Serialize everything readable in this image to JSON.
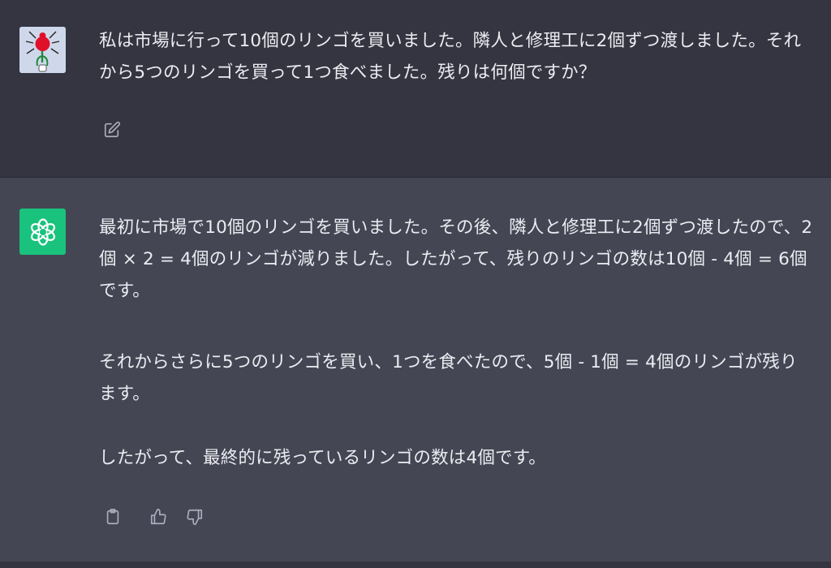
{
  "user_message": {
    "avatar_icon": "spider-avatar",
    "text": "私は市場に行って10個のリンゴを買いました。隣人と修理工に2個ずつ渡しました。それから5つのリンゴを買って1つ食べました。残りは何個ですか？",
    "actions": {
      "edit_icon": "edit-icon"
    }
  },
  "assistant_message": {
    "avatar_icon": "openai-logo-icon",
    "paragraphs": [
      "最初に市場で10個のリンゴを買いました。その後、隣人と修理工に2個ずつ渡したので、2個 × 2 = 4個のリンゴが減りました。したがって、残りのリンゴの数は10個 - 4個 = 6個です。",
      "それからさらに5つのリンゴを買い、1つを食べたので、5個 - 1個 = 4個のリンゴが残ります。",
      "したがって、最終的に残っているリンゴの数は4個です。"
    ],
    "actions": {
      "copy_icon": "clipboard-icon",
      "upvote_icon": "thumbs-up-icon",
      "downvote_icon": "thumbs-down-icon"
    }
  },
  "colors": {
    "user_bg": "#343541",
    "assistant_bg": "#444654",
    "assistant_avatar": "#19c37d",
    "text": "#ececf1",
    "icon": "#acacbe"
  }
}
